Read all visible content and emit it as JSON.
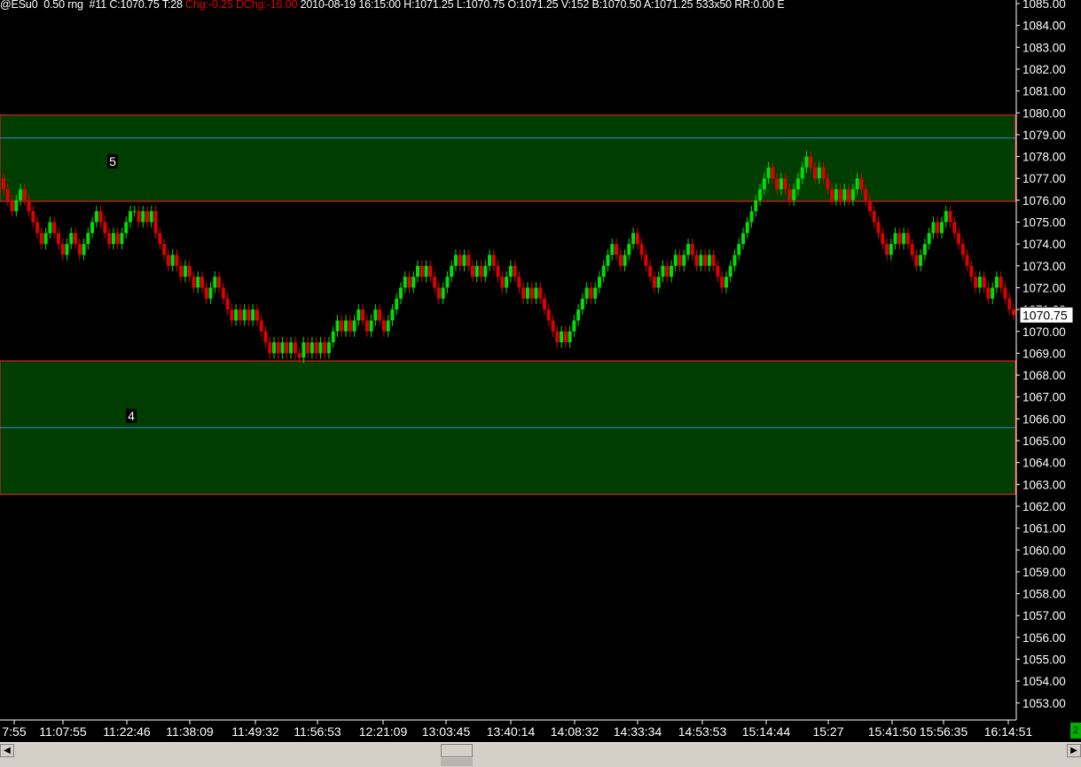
{
  "header": {
    "symbol": "@ESu0",
    "interval": "0.50 rng",
    "bar": "#11",
    "close": "C:1070.75",
    "ticks": "T:28",
    "chg": "Chg:-0.25",
    "dchg": "DChg:-16.00",
    "datetime": "2010-08-19 16:15:00",
    "high": "H:1071.25",
    "low": "L:1070.75",
    "open": "O:1071.25",
    "volume": "V:152",
    "bid": "B:1070.50",
    "ask": "A:1071.25",
    "size": "533x50",
    "rr": "RR:0.00 E"
  },
  "corner_label": "2",
  "chart_data": {
    "type": "candlestick",
    "title": "",
    "xlabel": "",
    "ylabel": "",
    "ylim": [
      1052.6,
      1085.3
    ],
    "grid": false,
    "y_ticks": [
      "1085.00",
      "1084.00",
      "1083.00",
      "1082.00",
      "1081.00",
      "1080.00",
      "1079.00",
      "1078.00",
      "1077.00",
      "1076.00",
      "1075.00",
      "1074.00",
      "1073.00",
      "1072.00",
      "1071.00",
      "1070.00",
      "1069.00",
      "1068.00",
      "1067.00",
      "1066.00",
      "1065.00",
      "1064.00",
      "1063.00",
      "1062.00",
      "1061.00",
      "1060.00",
      "1059.00",
      "1058.00",
      "1057.00",
      "1056.00",
      "1055.00",
      "1054.00",
      "1053.00"
    ],
    "x_ticks": [
      "7:55",
      "11:07:55",
      "11:22:46",
      "11:38:09",
      "11:49:32",
      "11:56:53",
      "12:21:09",
      "13:03:45",
      "13:40:14",
      "14:08:32",
      "14:33:34",
      "14:53:53",
      "15:14:44",
      "15:27",
      "15:41:50",
      "15:56:35",
      "16:14:51"
    ],
    "last_price": "1070.75",
    "zones": [
      {
        "label": "5",
        "top": 1079.9,
        "bottom": 1075.95,
        "mid": 1078.85
      },
      {
        "label": "4",
        "top": 1068.65,
        "bottom": 1062.55,
        "mid": 1065.6
      }
    ],
    "colors": {
      "up": "#00e000",
      "down": "#e00000",
      "zone_fill": "#003d00",
      "zone_border": "#ff2020",
      "mid_line": "#2f8fd8",
      "axis": "#ffffff"
    },
    "closes": [
      1076.5,
      1076.0,
      1075.5,
      1076.0,
      1076.5,
      1076.0,
      1075.5,
      1075.0,
      1074.5,
      1074.0,
      1074.5,
      1075.0,
      1074.5,
      1074.0,
      1073.5,
      1074.0,
      1074.5,
      1074.0,
      1073.5,
      1074.0,
      1074.5,
      1075.0,
      1075.5,
      1075.0,
      1074.5,
      1074.0,
      1074.5,
      1074.0,
      1074.5,
      1075.0,
      1075.5,
      1075.5,
      1075.0,
      1075.5,
      1075.0,
      1075.5,
      1074.5,
      1074.0,
      1073.5,
      1073.0,
      1073.5,
      1073.0,
      1072.5,
      1073.0,
      1072.5,
      1072.0,
      1072.5,
      1072.0,
      1071.5,
      1072.0,
      1072.5,
      1072.0,
      1071.5,
      1071.0,
      1070.5,
      1071.0,
      1070.5,
      1071.0,
      1070.5,
      1071.0,
      1070.5,
      1070.0,
      1069.5,
      1069.0,
      1069.5,
      1069.0,
      1069.5,
      1069.0,
      1069.5,
      1069.0,
      1068.8,
      1069.5,
      1069.0,
      1069.5,
      1069.0,
      1069.5,
      1069.0,
      1069.5,
      1070.0,
      1070.5,
      1070.0,
      1070.5,
      1070.0,
      1070.5,
      1071.0,
      1070.5,
      1070.0,
      1070.5,
      1071.0,
      1070.5,
      1070.0,
      1070.5,
      1071.0,
      1071.5,
      1072.0,
      1072.5,
      1072.0,
      1072.5,
      1073.0,
      1072.5,
      1073.0,
      1072.5,
      1072.0,
      1071.5,
      1072.0,
      1072.5,
      1073.0,
      1073.5,
      1073.0,
      1073.5,
      1073.0,
      1072.5,
      1073.0,
      1072.5,
      1073.0,
      1073.5,
      1073.0,
      1072.5,
      1072.0,
      1072.5,
      1073.0,
      1072.5,
      1072.0,
      1071.5,
      1072.0,
      1071.5,
      1072.0,
      1071.5,
      1071.0,
      1070.5,
      1070.0,
      1069.5,
      1070.0,
      1069.5,
      1070.0,
      1070.5,
      1071.0,
      1071.5,
      1072.0,
      1071.5,
      1072.0,
      1072.5,
      1073.0,
      1073.5,
      1074.0,
      1073.5,
      1073.0,
      1073.5,
      1074.0,
      1074.5,
      1074.0,
      1073.5,
      1073.0,
      1072.5,
      1072.0,
      1072.5,
      1073.0,
      1072.5,
      1073.0,
      1073.5,
      1073.0,
      1073.5,
      1074.0,
      1073.5,
      1073.0,
      1073.5,
      1073.0,
      1073.5,
      1073.0,
      1072.5,
      1072.0,
      1072.5,
      1073.0,
      1073.5,
      1074.0,
      1074.5,
      1075.0,
      1075.5,
      1076.0,
      1076.5,
      1077.0,
      1077.5,
      1077.0,
      1076.5,
      1077.0,
      1076.5,
      1076.0,
      1076.5,
      1077.0,
      1077.5,
      1078.0,
      1077.5,
      1077.0,
      1077.5,
      1077.0,
      1076.5,
      1076.0,
      1076.5,
      1076.0,
      1076.5,
      1076.0,
      1076.5,
      1077.0,
      1076.5,
      1076.0,
      1075.5,
      1075.0,
      1074.5,
      1074.0,
      1073.5,
      1074.0,
      1074.5,
      1074.0,
      1074.5,
      1074.0,
      1073.5,
      1073.0,
      1073.5,
      1074.0,
      1074.5,
      1075.0,
      1074.5,
      1075.0,
      1075.5,
      1075.0,
      1074.5,
      1074.0,
      1073.5,
      1073.0,
      1072.5,
      1072.0,
      1072.5,
      1072.0,
      1071.5,
      1072.0,
      1072.5,
      1072.0,
      1071.5,
      1071.0,
      1070.75
    ]
  }
}
